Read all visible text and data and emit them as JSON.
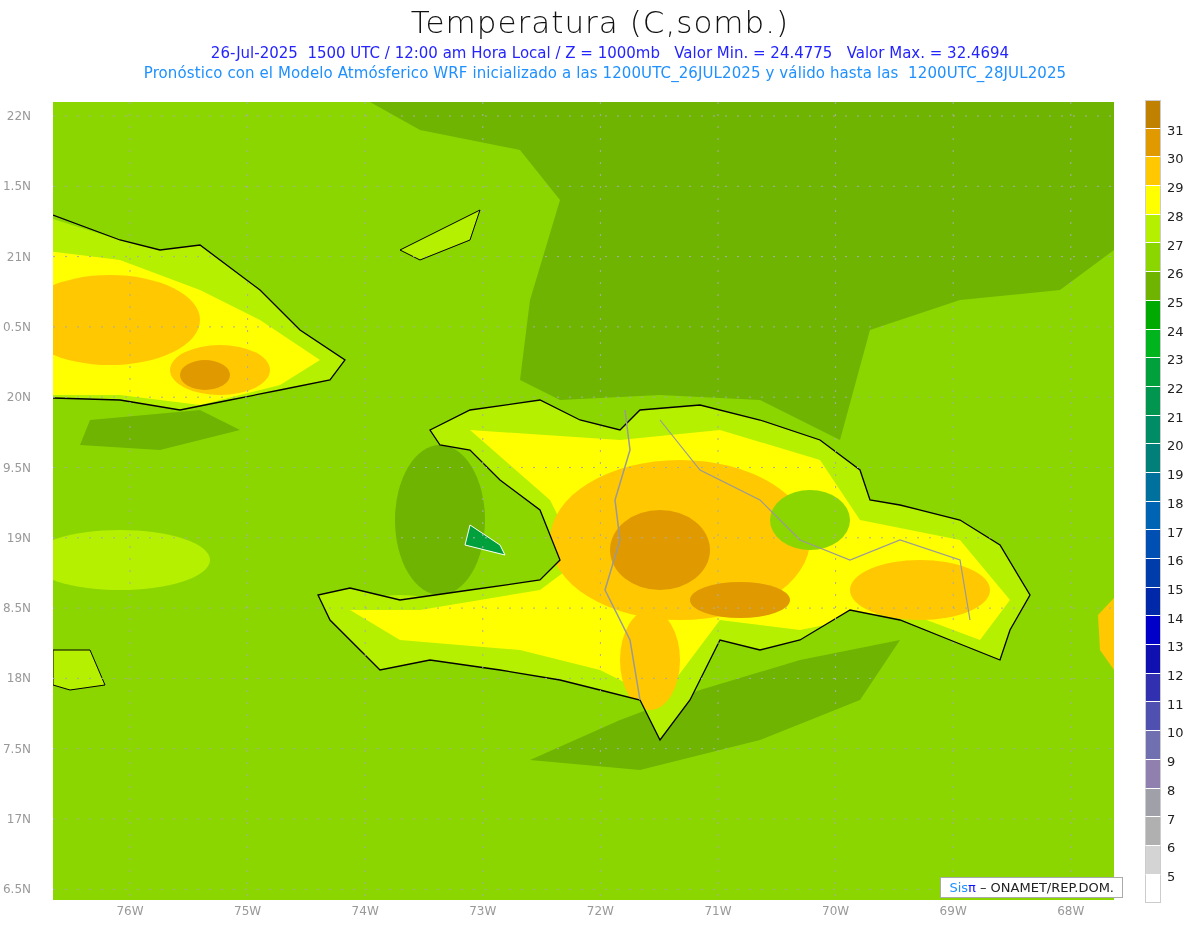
{
  "title": "Temperatura (C,somb.)",
  "subtitle": "26-Jul-2025  1500 UTC / 12:00 am Hora Local / Z = 1000mb   Valor Min. = 24.4775   Valor Max. = 32.4694",
  "description": "Pronóstico con el Modelo Atmósferico WRF inicializado a las 1200UTC_26JUL2025 y válido hasta las  1200UTC_28JUL2025",
  "lat_labels": [
    "22N",
    "1.5N",
    "21N",
    "0.5N",
    "20N",
    "9.5N",
    "19N",
    "8.5N",
    "18N",
    "7.5N",
    "17N",
    "6.5N"
  ],
  "lon_labels": [
    "76W",
    "75W",
    "74W",
    "73W",
    "72W",
    "71W",
    "70W",
    "69W",
    "68W"
  ],
  "credit": {
    "brand": "Sis",
    "symbol": "π",
    "text": " – ONAMET/REP.DOM."
  },
  "colorbar": {
    "cells": [
      {
        "color": "#c08000"
      },
      {
        "color": "#e09a00"
      },
      {
        "color": "#ffc800"
      },
      {
        "color": "#ffff00"
      },
      {
        "color": "#b4f000"
      },
      {
        "color": "#8cd600"
      },
      {
        "color": "#6eb400"
      },
      {
        "color": "#00aa00"
      },
      {
        "color": "#00b41e"
      },
      {
        "color": "#00a03c"
      },
      {
        "color": "#009650"
      },
      {
        "color": "#008c64"
      },
      {
        "color": "#008078"
      },
      {
        "color": "#00709c"
      },
      {
        "color": "#0064b4"
      },
      {
        "color": "#0050b4"
      },
      {
        "color": "#003caa"
      },
      {
        "color": "#0028a8"
      },
      {
        "color": "#0000c8"
      },
      {
        "color": "#1010b0"
      },
      {
        "color": "#3030b0"
      },
      {
        "color": "#5050b0"
      },
      {
        "color": "#7070b0"
      },
      {
        "color": "#9080b0"
      },
      {
        "color": "#a0a0a8"
      },
      {
        "color": "#b0b0b0"
      },
      {
        "color": "#d4d4d4"
      },
      {
        "color": "#ffffff"
      }
    ],
    "labels": [
      "31",
      "30",
      "29",
      "28",
      "27",
      "26",
      "25",
      "24",
      "23",
      "22",
      "21",
      "20",
      "19",
      "18",
      "17",
      "16",
      "15",
      "14",
      "13",
      "12",
      "11",
      "10",
      "9",
      "8",
      "7",
      "6",
      "5"
    ]
  }
}
